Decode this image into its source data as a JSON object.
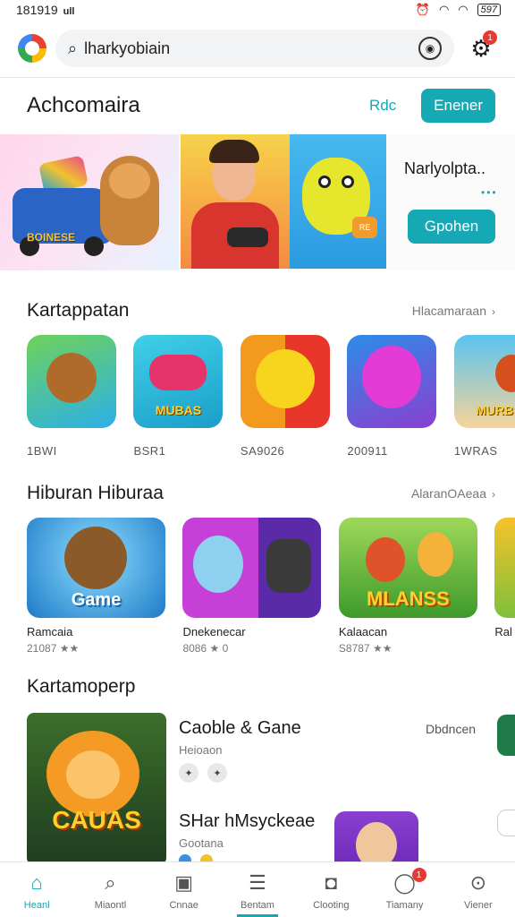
{
  "status_bar": {
    "time": "181919",
    "signal": "ull",
    "battery": "597"
  },
  "search": {
    "value": "lharkyobiain"
  },
  "notifications": {
    "badge": "1"
  },
  "hero": {
    "title": "Achcomaira",
    "link": "Rdc",
    "button": "Enener",
    "side_title": "Narlyolpta..",
    "side_dots": "•••",
    "side_button": "Gpohen",
    "tile1_text": "BOINESE",
    "tile3_tag": "RE"
  },
  "section1": {
    "title": "Kartappatan",
    "more": "Hlacamaraan",
    "items": [
      {
        "caption": "1BWI",
        "icon": "bear-with-controller",
        "color": "#f28c24",
        "word": ""
      },
      {
        "caption": "BSR1",
        "icon": "game-controller",
        "color": "#2ab6d9",
        "word": "MUBAS"
      },
      {
        "caption": "SA9026",
        "icon": "smiley-face",
        "color": "#e83a22",
        "word": ""
      },
      {
        "caption": "200911",
        "icon": "purple-monster",
        "color": "#2aa3e0",
        "word": ""
      },
      {
        "caption": "1WRAS",
        "icon": "beach-adventure",
        "color": "#e58a2a",
        "word": "MURBS"
      }
    ]
  },
  "section2": {
    "title": "Hiburan Hiburaa",
    "more": "AlaranOAeaa",
    "items": [
      {
        "name": "Ramcaia",
        "meta": "21087 ★★",
        "icon": "bear-gamer",
        "word": "Game"
      },
      {
        "name": "Dnekenecar",
        "meta": "8086 ★ 0",
        "icon": "blue-bear-controller",
        "word": ""
      },
      {
        "name": "Kalaacan",
        "meta": "S8787 ★★",
        "icon": "jungle-heroes",
        "word": "MLANSS"
      },
      {
        "name": "Ral",
        "meta": "",
        "icon": "partial-tile",
        "word": ""
      }
    ]
  },
  "section3": {
    "title": "Kartamoperp",
    "feature_word": "CAUAS",
    "item1": {
      "title": "Caoble & Gane",
      "sub": "Heioaon",
      "aside": "Dbdncen"
    },
    "item2": {
      "title": "SHar hMsyckeae",
      "sub": "Gootana"
    }
  },
  "bottom_nav": [
    {
      "label": "Heanl",
      "icon": "home-icon",
      "active": true
    },
    {
      "label": "Miaontl",
      "icon": "search-icon",
      "active": false
    },
    {
      "label": "Cnnae",
      "icon": "gift-icon",
      "active": false
    },
    {
      "label": "Bentam",
      "icon": "document-icon",
      "active": false
    },
    {
      "label": "Clooting",
      "icon": "games-icon",
      "active": false
    },
    {
      "label": "Tiamany",
      "icon": "chat-icon",
      "active": false,
      "badge": "1"
    },
    {
      "label": "Viener",
      "icon": "explore-icon",
      "active": false
    }
  ],
  "colors": {
    "accent": "#17a8b5",
    "badge": "#e53935"
  }
}
